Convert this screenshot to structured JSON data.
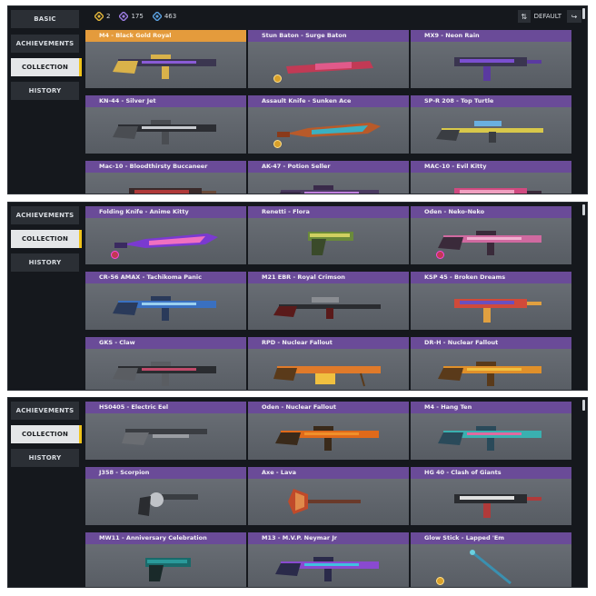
{
  "panels": [
    {
      "nav": [
        "BASIC",
        "ACHIEVEMENTS",
        "COLLECTION",
        "HISTORY"
      ],
      "active": "COLLECTION",
      "currencies": [
        {
          "value": "2",
          "color": "#e0b43a"
        },
        {
          "value": "175",
          "color": "#9b7be0"
        },
        {
          "value": "463",
          "color": "#5aa0e0"
        }
      ],
      "sort_label": "DEFAULT",
      "cards": [
        {
          "title": "M4 - Black Gold Royal",
          "highlight": true,
          "weapon": "rifle",
          "colors": [
            "#3b3650",
            "#8a5bd6",
            "#d9b24a"
          ]
        },
        {
          "title": "Stun Baton - Surge Baton",
          "weapon": "baton",
          "colors": [
            "#c23a55",
            "#e05a8a",
            "#7a2035"
          ],
          "badge": "gold"
        },
        {
          "title": "MX9 - Neon Rain",
          "weapon": "smg",
          "colors": [
            "#3a3550",
            "#7b4fd0",
            "#5a3aa0"
          ]
        },
        {
          "title": "KN-44 - Silver Jet",
          "weapon": "rifle",
          "colors": [
            "#2c2e33",
            "#c8cbd0",
            "#4a4d52"
          ]
        },
        {
          "title": "Assault Knife - Sunken Ace",
          "weapon": "knife",
          "colors": [
            "#b85a2a",
            "#3bb0c0",
            "#8a3a1a"
          ],
          "badge": "gold"
        },
        {
          "title": "SP-R 208 - Top Turtle",
          "weapon": "sniper",
          "colors": [
            "#d8c84a",
            "#6ab0e0",
            "#3a3d42"
          ]
        },
        {
          "title": "Mac-10 - Bloodthirsty Buccaneer",
          "weapon": "smg",
          "colors": [
            "#3a2a2a",
            "#b03a3a",
            "#6a4a3a"
          ]
        },
        {
          "title": "AK-47 - Potion Seller",
          "weapon": "rifle",
          "colors": [
            "#4a3a60",
            "#c080e0",
            "#3a2a4a"
          ]
        },
        {
          "title": "MAC-10 - Evil Kitty",
          "weapon": "smg",
          "colors": [
            "#d04a80",
            "#f0a0c0",
            "#3a2a3a"
          ]
        }
      ]
    },
    {
      "nav": [
        "ACHIEVEMENTS",
        "COLLECTION",
        "HISTORY"
      ],
      "active": "COLLECTION",
      "cards": [
        {
          "title": "Folding Knife - Anime Kitty",
          "weapon": "knife",
          "colors": [
            "#7a3ad0",
            "#f070c0",
            "#3a2a60"
          ],
          "badge": "pink"
        },
        {
          "title": "Renetti - Flora",
          "weapon": "pistol",
          "colors": [
            "#6a8a3a",
            "#d0d060",
            "#3a4a2a"
          ]
        },
        {
          "title": "Oden - Neko-Neko",
          "weapon": "rifle",
          "colors": [
            "#d06aa0",
            "#f0b0d0",
            "#3a2a3a"
          ],
          "badge": "pink"
        },
        {
          "title": "CR-56 AMAX - Tachikoma Panic",
          "weapon": "rifle",
          "colors": [
            "#3a70c0",
            "#9ad0f0",
            "#2a3a5a"
          ]
        },
        {
          "title": "M21 EBR - Royal Crimson",
          "weapon": "sniper",
          "colors": [
            "#2a2c30",
            "#8a8d92",
            "#5a1a1a"
          ]
        },
        {
          "title": "KSP 45 - Broken Dreams",
          "weapon": "smg",
          "colors": [
            "#d04a3a",
            "#6a50c0",
            "#e0a040"
          ]
        },
        {
          "title": "GKS - Claw",
          "weapon": "rifle",
          "colors": [
            "#2a2c30",
            "#c04a6a",
            "#5a5d62"
          ]
        },
        {
          "title": "RPD - Nuclear Fallout",
          "weapon": "lmg",
          "colors": [
            "#e07a2a",
            "#f0c040",
            "#5a3a1a"
          ]
        },
        {
          "title": "DR-H - Nuclear Fallout",
          "weapon": "rifle",
          "colors": [
            "#e0902a",
            "#f0c040",
            "#5a3a1a"
          ]
        }
      ]
    },
    {
      "nav": [
        "ACHIEVEMENTS",
        "COLLECTION",
        "HISTORY"
      ],
      "active": "COLLECTION",
      "cards": [
        {
          "title": "HS0405 - Electric Eel",
          "weapon": "shotgun",
          "colors": [
            "#3a3d42",
            "#9a9da2",
            "#6a6d72"
          ]
        },
        {
          "title": "Oden - Nuclear Fallout",
          "weapon": "rifle",
          "colors": [
            "#e06a1a",
            "#f0902a",
            "#3a2a1a"
          ]
        },
        {
          "title": "M4 - Hang Ten",
          "weapon": "rifle",
          "colors": [
            "#3ab0b0",
            "#e06aa0",
            "#2a4a5a"
          ]
        },
        {
          "title": "J358 - Scorpion",
          "weapon": "revolver",
          "colors": [
            "#3a3d42",
            "#c0c3c8",
            "#2a2c30"
          ]
        },
        {
          "title": "Axe - Lava",
          "weapon": "axe",
          "colors": [
            "#c04a2a",
            "#e08a4a",
            "#6a3a2a"
          ]
        },
        {
          "title": "HG 40 - Clash of Giants",
          "weapon": "smg",
          "colors": [
            "#2a2c30",
            "#e0e0e0",
            "#b03a3a"
          ]
        },
        {
          "title": "MW11 - Anniversary Celebration",
          "weapon": "pistol",
          "colors": [
            "#1a6a6a",
            "#2a9a9a",
            "#1a2a2a"
          ]
        },
        {
          "title": "M13 - M.V.P. Neymar Jr",
          "weapon": "rifle",
          "colors": [
            "#8a4ad0",
            "#40c0e0",
            "#2a2a4a"
          ]
        },
        {
          "title": "Glow Stick - Lapped 'Em",
          "weapon": "stick",
          "colors": [
            "#3a90b0",
            "#6ad0e0",
            "#2a4a5a"
          ],
          "badge": "gold"
        }
      ]
    }
  ]
}
